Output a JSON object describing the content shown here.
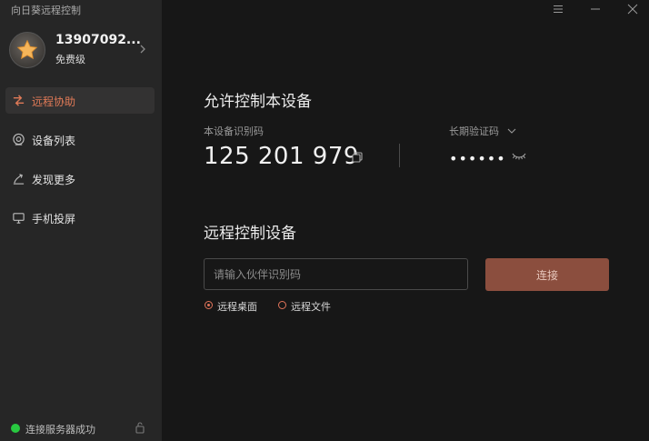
{
  "app": {
    "title": "向日葵远程控制"
  },
  "profile": {
    "username": "13907092...",
    "tier": "免费级"
  },
  "sidebar": {
    "items": [
      {
        "label": "远程协助",
        "icon": "remote-assist-icon",
        "active": true
      },
      {
        "label": "设备列表",
        "icon": "device-list-icon",
        "active": false
      },
      {
        "label": "发现更多",
        "icon": "discover-icon",
        "active": false
      },
      {
        "label": "手机投屏",
        "icon": "screen-cast-icon",
        "active": false
      }
    ]
  },
  "status": {
    "text": "连接服务器成功",
    "color": "#28c840"
  },
  "allow_section": {
    "title": "允许控制本设备",
    "device_id_label": "本设备识别码",
    "device_id": "125 201 979",
    "code_label": "长期验证码",
    "code_value": "••••••"
  },
  "remote_section": {
    "title": "远程控制设备",
    "input_placeholder": "请输入伙伴识别码",
    "input_value": "",
    "connect_label": "连接",
    "options": [
      {
        "label": "远程桌面",
        "checked": true
      },
      {
        "label": "远程文件",
        "checked": false
      }
    ]
  },
  "colors": {
    "accent": "#e07a57",
    "connect_button": "#8b4e3e",
    "sidebar_bg": "#262626",
    "main_bg": "#171717"
  }
}
